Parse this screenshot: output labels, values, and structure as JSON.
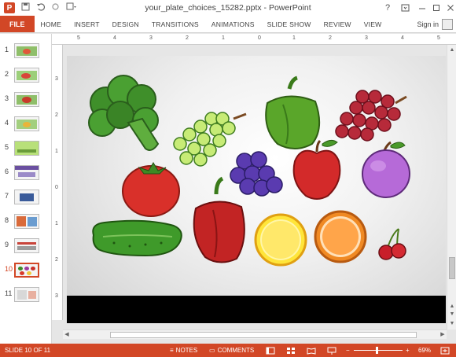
{
  "window": {
    "app_icon": "P",
    "title": "your_plate_choices_15282.pptx - PowerPoint",
    "help_label": "?",
    "controls": [
      "help-icon",
      "ribbon-options-icon",
      "minimize-icon",
      "maximize-icon",
      "close-icon"
    ]
  },
  "quick_access": {
    "icons": [
      "save-icon",
      "undo-icon",
      "redo-icon",
      "customize-icon"
    ]
  },
  "ribbon": {
    "file_label": "FILE",
    "tabs": [
      "HOME",
      "INSERT",
      "DESIGN",
      "TRANSITIONS",
      "ANIMATIONS",
      "SLIDE SHOW",
      "REVIEW",
      "VIEW"
    ],
    "signin_label": "Sign in"
  },
  "rulers": {
    "horizontal": [
      "5",
      "4",
      "3",
      "2",
      "1",
      "0",
      "1",
      "2",
      "3",
      "4",
      "5"
    ],
    "vertical": [
      "3",
      "2",
      "1",
      "0",
      "1",
      "2",
      "3"
    ]
  },
  "slides": {
    "numbers": [
      "1",
      "2",
      "3",
      "4",
      "5",
      "6",
      "7",
      "8",
      "9",
      "10",
      "11"
    ],
    "active_index": 10
  },
  "status": {
    "slide_label": "SLIDE 10 OF 11",
    "notes_label": "NOTES",
    "comments_label": "COMMENTS",
    "zoom_minus": "−",
    "zoom_plus": "+",
    "zoom_value": "69%",
    "zoom_level_percent": 69
  },
  "colors": {
    "accent": "#d24726",
    "status_bar": "#d24726"
  }
}
